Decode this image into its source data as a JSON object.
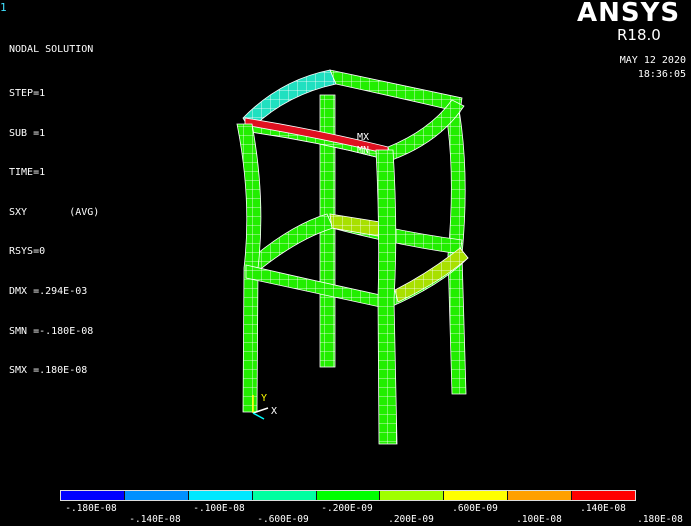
{
  "window_number": "1",
  "header": {
    "title": "NODAL SOLUTION",
    "lines": [
      "STEP=1",
      "SUB =1",
      "TIME=1",
      "SXY       (AVG)",
      "RSYS=0",
      "DMX =.294E-03",
      "SMN =-.180E-08",
      "SMX =.180E-08"
    ]
  },
  "brand": {
    "name": "ANSYS",
    "release": "R18.0"
  },
  "date": "MAY 12 2020",
  "time": "18:36:05",
  "markers": {
    "max": "MX",
    "min": "MN"
  },
  "axes": {
    "y": "Y",
    "x": "X"
  },
  "legend": {
    "colors": [
      "#0000ff",
      "#0090ff",
      "#00e8ff",
      "#00ffa0",
      "#00ff00",
      "#a0ff00",
      "#ffff00",
      "#ffa000",
      "#ff0000"
    ],
    "top_labels": [
      "-.180E-08",
      "-.100E-08",
      "-.200E-09",
      ".600E-09",
      ".140E-08"
    ],
    "bottom_labels": [
      "-.140E-08",
      "-.600E-09",
      ".200E-09",
      ".100E-08",
      ".180E-08"
    ]
  },
  "colors": {
    "element": "#22ee00",
    "edge": "#ffffff"
  }
}
